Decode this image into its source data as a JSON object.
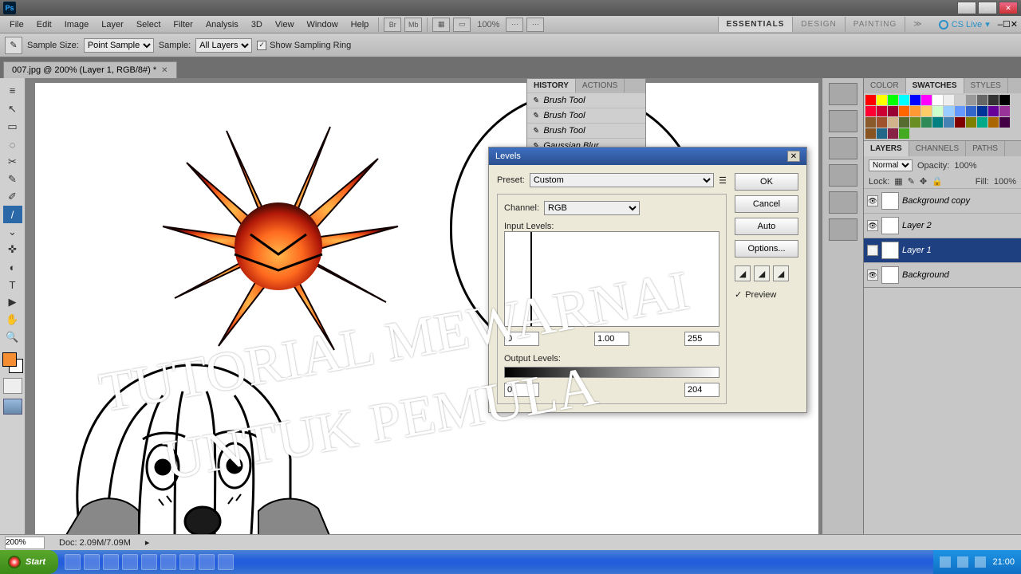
{
  "titlebar": {
    "logo": "Ps"
  },
  "menubar": {
    "items": [
      "File",
      "Edit",
      "Image",
      "Layer",
      "Select",
      "Filter",
      "Analysis",
      "3D",
      "View",
      "Window",
      "Help"
    ],
    "zoom": "100%",
    "workspaces": [
      "ESSENTIALS",
      "DESIGN",
      "PAINTING"
    ],
    "active_workspace": 0,
    "cslive": "CS Live"
  },
  "options": {
    "sample_size_label": "Sample Size:",
    "sample_size_value": "Point Sample",
    "sample_label": "Sample:",
    "sample_value": "All Layers",
    "show_ring": "Show Sampling Ring"
  },
  "doc_tab": {
    "label": "007.jpg @ 200% (Layer 1, RGB/8#) *"
  },
  "toolbox": {
    "tools": [
      "↖",
      "▭",
      "◌",
      "✂",
      "✎",
      "✐",
      "/",
      "⌄",
      "✜",
      "◐",
      "T",
      "▶",
      "✋",
      "🔍"
    ],
    "active": 6,
    "fg": "#f58d33",
    "bg": "#ffffff"
  },
  "history": {
    "tabs": [
      "HISTORY",
      "ACTIONS"
    ],
    "active": 0,
    "items": [
      "Brush Tool",
      "Brush Tool",
      "Brush Tool",
      "Gaussian Blur"
    ]
  },
  "levels": {
    "title": "Levels",
    "preset_label": "Preset:",
    "preset_value": "Custom",
    "channel_label": "Channel:",
    "channel_value": "RGB",
    "input_levels_label": "Input Levels:",
    "in_low": "0",
    "in_mid": "1.00",
    "in_high": "255",
    "output_levels_label": "Output Levels:",
    "out_low": "0",
    "out_high": "204",
    "ok": "OK",
    "cancel": "Cancel",
    "auto": "Auto",
    "options": "Options...",
    "preview": "Preview"
  },
  "swatches_tabs": [
    "COLOR",
    "SWATCHES",
    "STYLES"
  ],
  "swatches_active": 1,
  "swatches_colors": [
    "#ff0000",
    "#ffff00",
    "#00ff00",
    "#00ffff",
    "#0000ff",
    "#ff00ff",
    "#ffffff",
    "#eeeeee",
    "#cccccc",
    "#999999",
    "#666666",
    "#333333",
    "#000000",
    "#ff0033",
    "#cc0033",
    "#990033",
    "#ff6600",
    "#ff9933",
    "#ffcc66",
    "#ccffcc",
    "#99ccff",
    "#6699ff",
    "#3366cc",
    "#003399",
    "#660099",
    "#993399",
    "#8b5a2b",
    "#a0522d",
    "#d2b48c",
    "#556b2f",
    "#6b8e23",
    "#2e8b57",
    "#008080",
    "#4682b4",
    "#800000",
    "#808000",
    "#00aa88",
    "#aa6600",
    "#440044",
    "#885522",
    "#226688",
    "#882244",
    "#44aa22"
  ],
  "layers": {
    "tabs": [
      "LAYERS",
      "CHANNELS",
      "PATHS"
    ],
    "active": 0,
    "blendmode": "Normal",
    "opacity_label": "Opacity:",
    "opacity": "100%",
    "lock_label": "Lock:",
    "fill_label": "Fill:",
    "fill": "100%",
    "items": [
      {
        "name": "Background copy",
        "active": false
      },
      {
        "name": "Layer 2",
        "active": false
      },
      {
        "name": "Layer 1",
        "active": true
      },
      {
        "name": "Background",
        "active": false
      }
    ]
  },
  "overlay": {
    "line1": "TUTORIAL MEWARNAI",
    "line2": "UNTUK PEMULA"
  },
  "status": {
    "zoom": "200%",
    "doc": "Doc: 2.09M/7.09M"
  },
  "taskbar": {
    "start": "Start",
    "clock": "21:00"
  }
}
